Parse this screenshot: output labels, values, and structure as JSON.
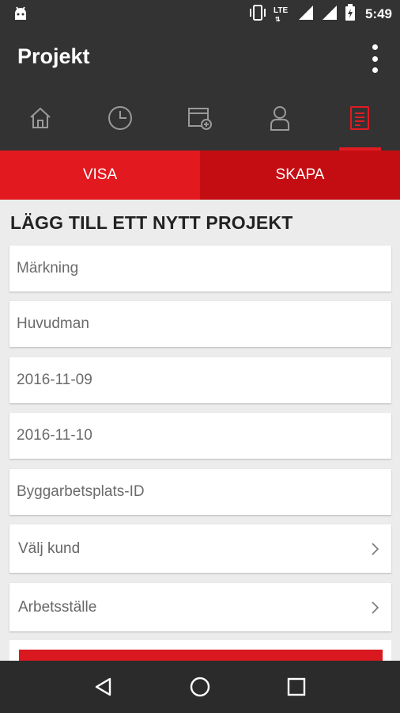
{
  "status_bar": {
    "network": "LTE",
    "time": "5:49",
    "icons": [
      "android-icon",
      "vibrate-icon",
      "lte-icon",
      "signal-icon",
      "signal-icon",
      "battery-charging-icon"
    ]
  },
  "app_bar": {
    "title": "Projekt",
    "menu_icon": "more-vert-icon"
  },
  "tabs": [
    {
      "icon": "home-icon",
      "active": false
    },
    {
      "icon": "clock-icon",
      "active": false
    },
    {
      "icon": "calendar-add-icon",
      "active": false
    },
    {
      "icon": "person-icon",
      "active": false
    },
    {
      "icon": "document-icon",
      "active": true
    }
  ],
  "segments": {
    "visa": "VISA",
    "skapa": "SKAPA"
  },
  "form": {
    "title": "LÄGG TILL ETT NYTT PROJEKT",
    "fields": [
      {
        "value": "Märkning"
      },
      {
        "value": "Huvudman"
      },
      {
        "value": "2016-11-09"
      },
      {
        "value": "2016-11-10"
      },
      {
        "value": "Byggarbetsplats-ID"
      }
    ],
    "selects": [
      {
        "value": "Välj kund"
      },
      {
        "value": "Arbetsställe"
      }
    ]
  },
  "nav": [
    "back-icon",
    "home-circle-icon",
    "recents-icon"
  ],
  "colors": {
    "accent": "#e21b22",
    "accent_dark": "#c40d12",
    "bar": "#333333"
  }
}
